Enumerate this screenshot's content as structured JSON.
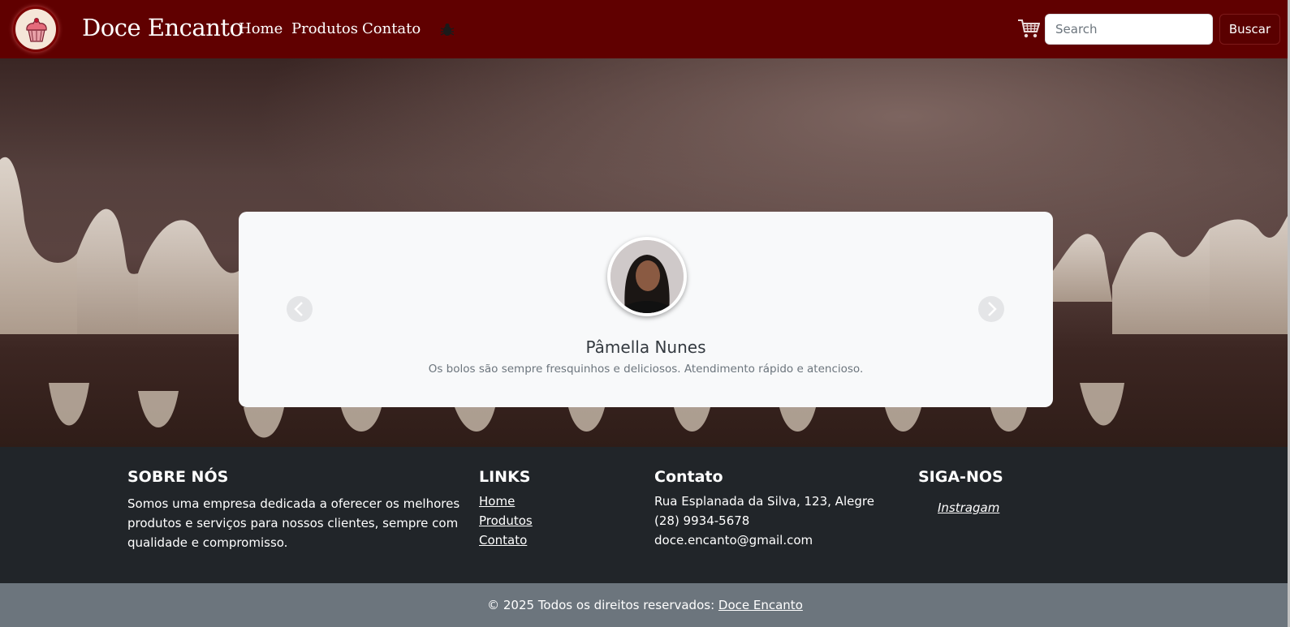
{
  "navbar": {
    "brand": "Doce Encanto",
    "links": [
      {
        "label": "Home"
      },
      {
        "label": "Produtos"
      },
      {
        "label": "Contato"
      }
    ],
    "theme_icon": "bug-icon",
    "cart_icon": "cart-icon",
    "search": {
      "placeholder": "Search",
      "value": ""
    },
    "search_button": "Buscar",
    "logo_icon": "cupcake-icon"
  },
  "testimonial": {
    "name": "Pâmella Nunes",
    "text": "Os bolos são sempre fresquinhos e deliciosos. Atendimento rápido e atencioso.",
    "prev_icon": "chevron-left-icon",
    "next_icon": "chevron-right-icon"
  },
  "footer": {
    "about": {
      "title": "SOBRE NÓS",
      "text": "Somos uma empresa dedicada a oferecer os melhores produtos e serviços para nossos clientes, sempre com qualidade e compromisso."
    },
    "links": {
      "title": "LINKS",
      "items": [
        {
          "label": "Home"
        },
        {
          "label": "Produtos"
        },
        {
          "label": "Contato"
        }
      ]
    },
    "contact": {
      "title": "Contato",
      "address": "Rua Esplanada da Silva, 123, Alegre",
      "phone": "(28) 9934-5678",
      "email": "doce.encanto@gmail.com"
    },
    "follow": {
      "title": "SIGA-NOS",
      "instagram": "Instragam"
    }
  },
  "copyright": {
    "text": "© 2025 Todos os direitos reservados: ",
    "link": "Doce Encanto"
  },
  "colors": {
    "navbar": "#600000",
    "footer": "#212529",
    "bottom_bar": "#6c757d",
    "card": "#f8f9fa"
  }
}
